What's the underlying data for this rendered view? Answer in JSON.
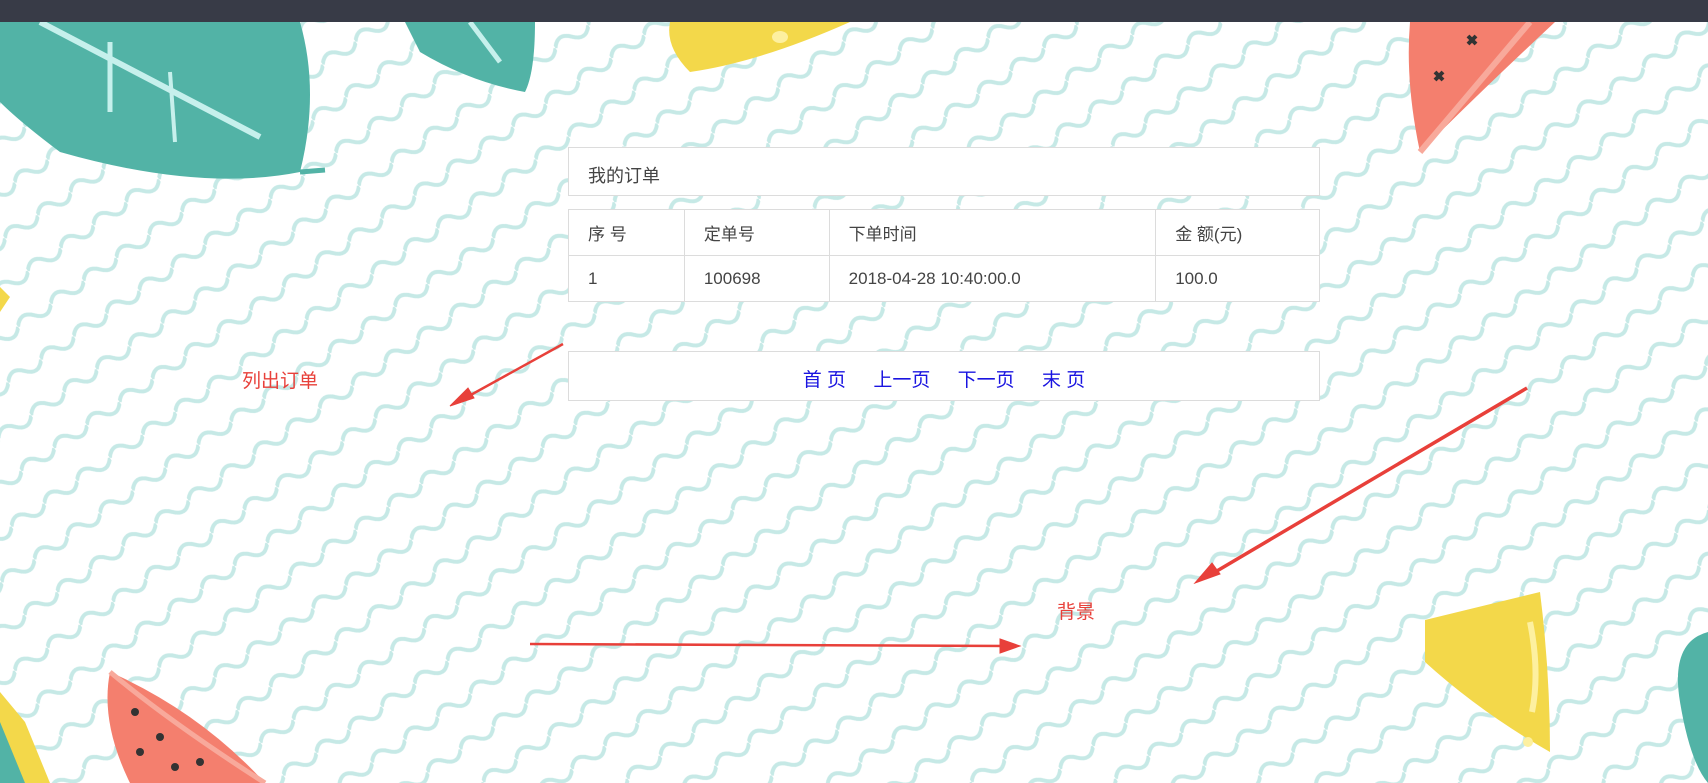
{
  "header": {
    "title": "我的订单"
  },
  "table": {
    "columns": [
      "序 号",
      "定单号",
      "下单时间",
      "金 额(元)"
    ],
    "rows": [
      [
        "1",
        "100698",
        "2018-04-28 10:40:00.0",
        "100.0"
      ]
    ]
  },
  "pager": {
    "first": "首 页",
    "prev": "上一页",
    "next": "下一页",
    "last": "末 页"
  },
  "annotations": {
    "list_orders": "列出订单",
    "background": "背景",
    "color": "#e8403a"
  },
  "colors": {
    "link": "#1a14e0",
    "wave": "#bfe6e3",
    "leaf": "#52b3a6",
    "watermelon": "#f47f6e",
    "cheese": "#f3d84a",
    "topbar": "#383b47"
  }
}
